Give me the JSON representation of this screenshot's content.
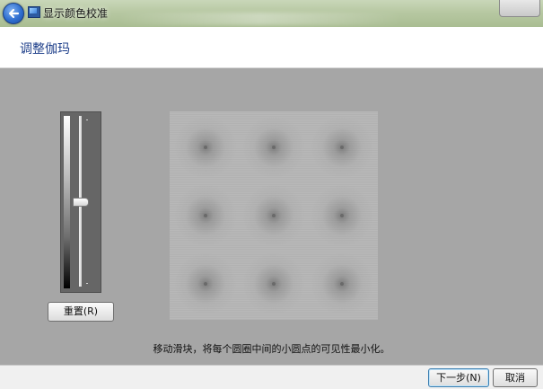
{
  "window": {
    "title": "显示颜色校准",
    "back_icon": "back-arrow-icon",
    "app_icon": "display-calibration-icon"
  },
  "header": {
    "title": "调整伽玛"
  },
  "gamma_slider": {
    "level": 0.5,
    "reset_label": "重置(R)"
  },
  "instruction": "移动滑块，将每个圆圈中间的小圆点的可见性最小化。",
  "footer": {
    "next_label": "下一步(N)",
    "cancel_label": "取消"
  },
  "colors": {
    "title_text": "#1e3f8a",
    "background": "#a6a6a6",
    "pattern_background": "#b8b8b8"
  }
}
